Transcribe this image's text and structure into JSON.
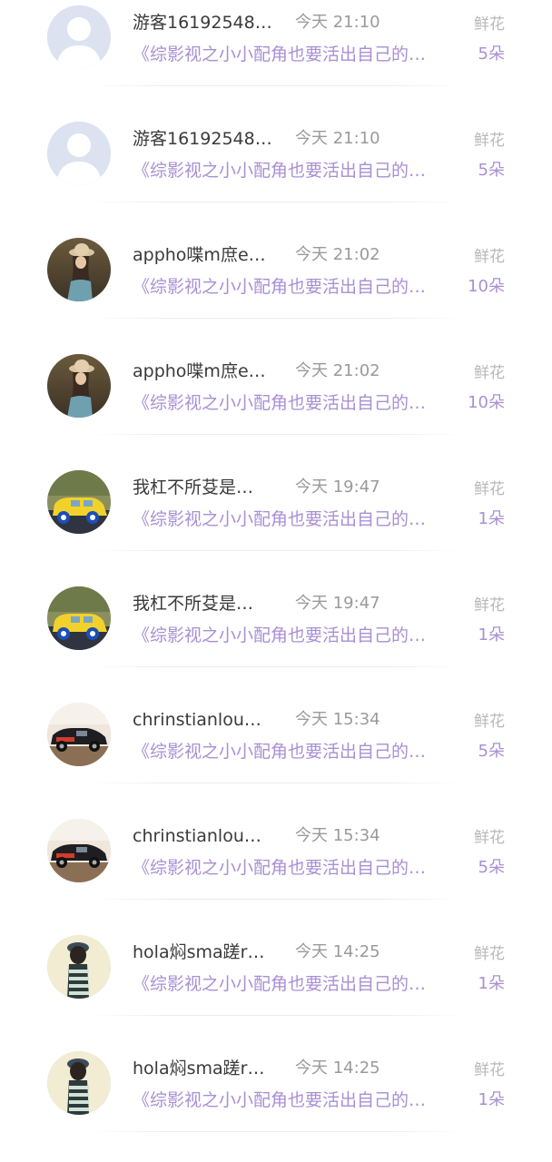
{
  "gifts": [
    {
      "name": "游客16192548…",
      "time": "今天 21:10",
      "gift_label": "鲜花",
      "book": "《综影视之小小配角也要活出自己的…",
      "count": "5朵",
      "avatar": "default-avatar-icon"
    },
    {
      "name": "游客16192548…",
      "time": "今天 21:10",
      "gift_label": "鲜花",
      "book": "《综影视之小小配角也要活出自己的…",
      "count": "5朵",
      "avatar": "default-avatar-icon"
    },
    {
      "name": "appho喋m庶e…",
      "time": "今天 21:02",
      "gift_label": "鲜花",
      "book": "《综影视之小小配角也要活出自己的…",
      "count": "10朵",
      "avatar": "girl-hat-avatar"
    },
    {
      "name": "appho喋m庶e…",
      "time": "今天 21:02",
      "gift_label": "鲜花",
      "book": "《综影视之小小配角也要活出自己的…",
      "count": "10朵",
      "avatar": "girl-hat-avatar"
    },
    {
      "name": "我杠不所芟是…",
      "time": "今天 19:47",
      "gift_label": "鲜花",
      "book": "《综影视之小小配角也要活出自己的…",
      "count": "1朵",
      "avatar": "yellow-car-avatar"
    },
    {
      "name": "我杠不所芟是…",
      "time": "今天 19:47",
      "gift_label": "鲜花",
      "book": "《综影视之小小配角也要活出自己的…",
      "count": "1朵",
      "avatar": "yellow-car-avatar"
    },
    {
      "name": "chrinstianlou…",
      "time": "今天 15:34",
      "gift_label": "鲜花",
      "book": "《综影视之小小配角也要活出自己的…",
      "count": "5朵",
      "avatar": "black-car-avatar"
    },
    {
      "name": "chrinstianlou…",
      "time": "今天 15:34",
      "gift_label": "鲜花",
      "book": "《综影视之小小配角也要活出自己的…",
      "count": "5朵",
      "avatar": "black-car-avatar"
    },
    {
      "name": "hola焖sma蹉r…",
      "time": "今天 14:25",
      "gift_label": "鲜花",
      "book": "《综影视之小小配角也要活出自己的…",
      "count": "1朵",
      "avatar": "girl-striped-avatar"
    },
    {
      "name": "hola焖sma蹉r…",
      "time": "今天 14:25",
      "gift_label": "鲜花",
      "book": "《综影视之小小配角也要活出自己的…",
      "count": "1朵",
      "avatar": "girl-striped-avatar"
    }
  ]
}
